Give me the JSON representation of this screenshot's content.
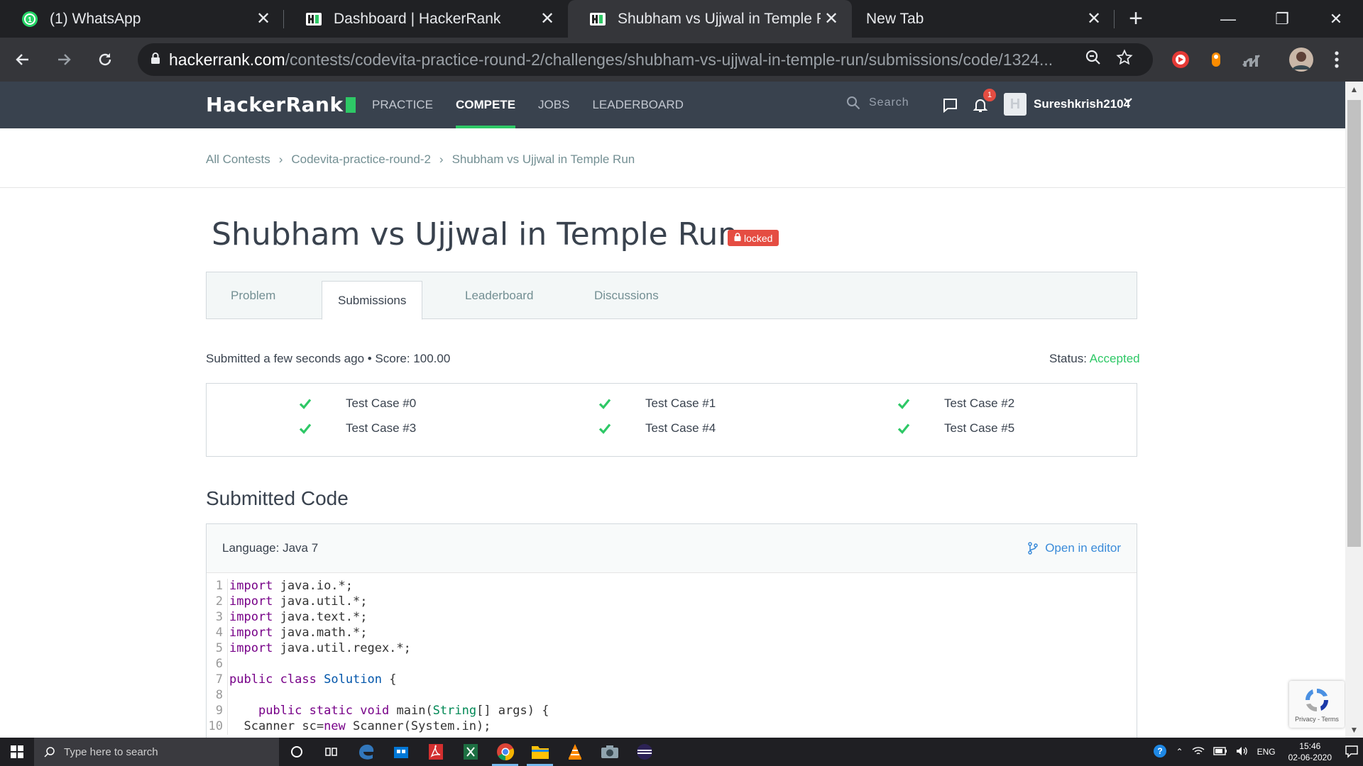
{
  "browser": {
    "tabs": [
      {
        "title": "(1) WhatsApp",
        "icon": "whatsapp-icon",
        "active": false
      },
      {
        "title": "Dashboard | HackerRank",
        "icon": "hackerrank-icon",
        "active": false
      },
      {
        "title": "Shubham vs Ujjwal in Temple Ru",
        "icon": "hackerrank-icon",
        "active": true
      },
      {
        "title": "New Tab",
        "icon": "",
        "active": false
      }
    ],
    "url_host": "hackerrank.com",
    "url_path": "/contests/codevita-practice-round-2/challenges/shubham-vs-ujjwal-in-temple-run/submissions/code/1324..."
  },
  "hr_nav": {
    "logo": "HackerRank",
    "menu": [
      "PRACTICE",
      "COMPETE",
      "JOBS",
      "LEADERBOARD"
    ],
    "active_menu": "COMPETE",
    "search_placeholder": "Search",
    "notification_count": "1",
    "avatar_letter": "H",
    "username": "Sureshkrish2104"
  },
  "breadcrumb": [
    "All Contests",
    "Codevita-practice-round-2",
    "Shubham vs Ujjwal in Temple Run"
  ],
  "challenge": {
    "title": "Shubham vs Ujjwal in Temple Run",
    "badge": "locked"
  },
  "tabs": [
    "Problem",
    "Submissions",
    "Leaderboard",
    "Discussions"
  ],
  "active_tab": "Submissions",
  "submission": {
    "summary": "Submitted a few seconds ago • Score: 100.00",
    "status_label": "Status:",
    "status_value": "Accepted",
    "test_cases": [
      "Test Case #0",
      "Test Case #1",
      "Test Case #2",
      "Test Case #3",
      "Test Case #4",
      "Test Case #5"
    ]
  },
  "code_section": {
    "heading": "Submitted Code",
    "language": "Language: Java 7",
    "open_in_editor": "Open in editor",
    "lines": [
      {
        "n": "1",
        "code": "import java.io.*;"
      },
      {
        "n": "2",
        "code": "import java.util.*;"
      },
      {
        "n": "3",
        "code": "import java.text.*;"
      },
      {
        "n": "4",
        "code": "import java.math.*;"
      },
      {
        "n": "5",
        "code": "import java.util.regex.*;"
      },
      {
        "n": "6",
        "code": ""
      },
      {
        "n": "7",
        "code": "public class Solution {"
      },
      {
        "n": "8",
        "code": ""
      },
      {
        "n": "9",
        "code": "    public static void main(String[] args) {"
      },
      {
        "n": "10",
        "code": "  Scanner sc=new Scanner(System.in);"
      }
    ]
  },
  "recaptcha_text": "Privacy - Terms",
  "taskbar": {
    "search_placeholder": "Type here to search",
    "lang": "ENG",
    "time": "15:46",
    "date": "02-06-2020"
  },
  "colors": {
    "hr_nav_bg": "#39424e",
    "hr_green": "#2ec866",
    "locked_red": "#e54d42",
    "link_blue": "#3a8bd9"
  }
}
